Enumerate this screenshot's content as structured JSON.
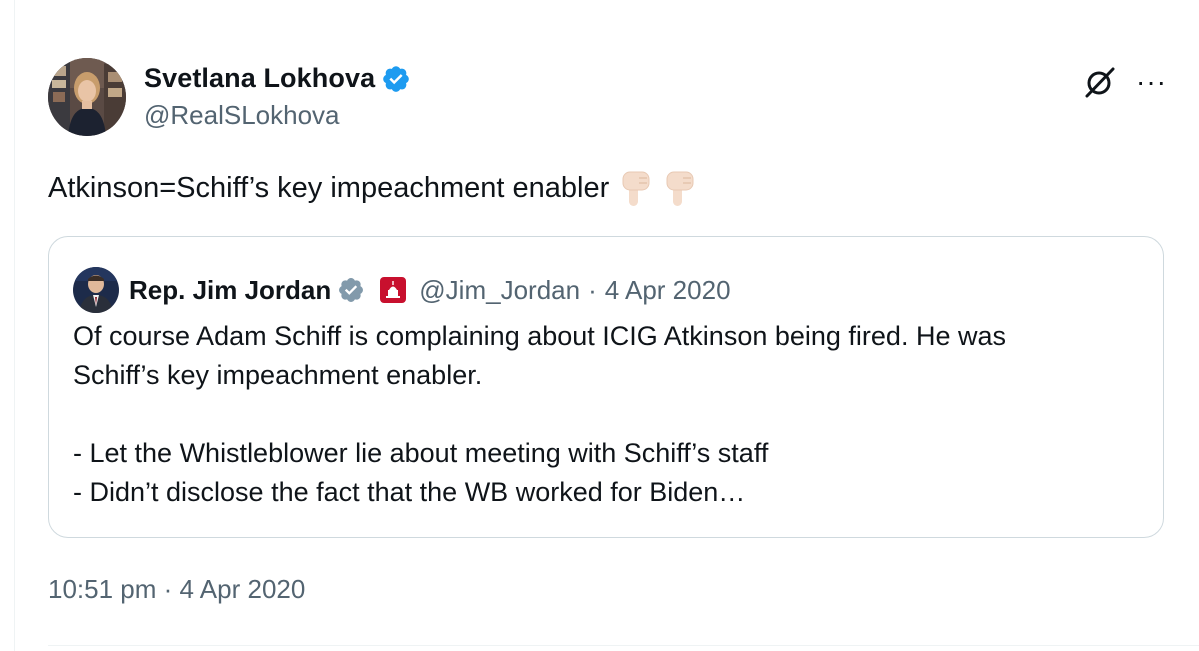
{
  "author": {
    "name": "Svetlana Lokhova",
    "handle": "@RealSLokhova",
    "verified_color": "#1d9bf0"
  },
  "tweet": {
    "text": "Atkinson=Schiff’s key impeachment enabler",
    "emojis": [
      "pointing-down-hand-light-skin",
      "pointing-down-hand-light-skin"
    ]
  },
  "quoted_tweet": {
    "author_name": "Rep. Jim Jordan",
    "verified_color": "#829aab",
    "affiliate_badge": "us-capitol-badge-icon",
    "handle": "@Jim_Jordan",
    "separator": "·",
    "date": "4 Apr 2020",
    "lines": [
      "Of course Adam Schiff is complaining about ICIG Atkinson being fired. He was",
      "Schiff’s key impeachment enabler.",
      "",
      "- Let the Whistleblower lie about meeting with Schiff’s staff",
      "- Didn’t disclose the fact that the WB worked for Biden…"
    ]
  },
  "meta": {
    "time": "10:51 pm",
    "separator": "·",
    "date": "4 Apr 2020"
  },
  "icons": {
    "top_right": [
      "grok-icon",
      "more-icon"
    ],
    "more_glyph": "···"
  },
  "colors": {
    "text": "#0f1419",
    "secondary": "#536471",
    "border": "#cfd9de",
    "accent": "#1d9bf0"
  }
}
